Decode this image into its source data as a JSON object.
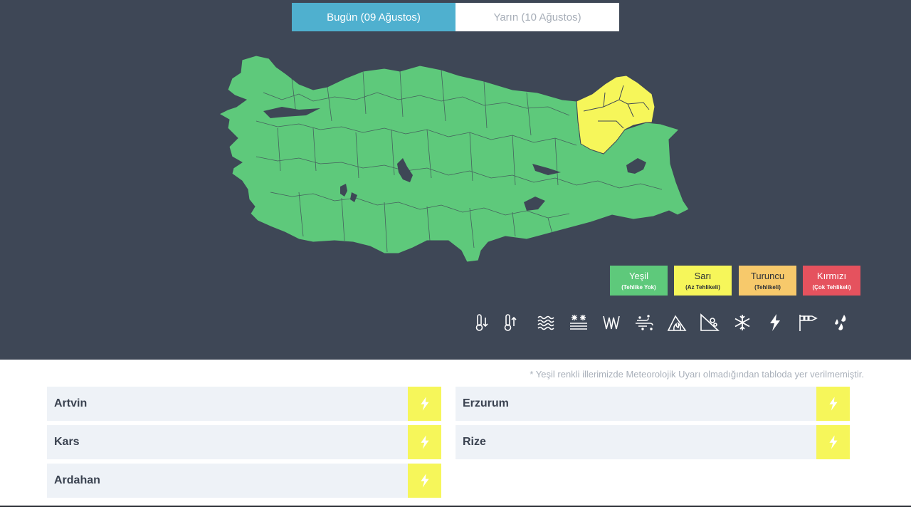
{
  "tabs": {
    "today": "Bugün (09 Ağustos)",
    "tomorrow": "Yarın (10 Ağustos)"
  },
  "colors": {
    "green": "#5ec97b",
    "yellow": "#f6f65a",
    "orange": "#f7c96b",
    "red": "#e5525e",
    "background": "#3e4756"
  },
  "legend": [
    {
      "title": "Yeşil",
      "sub": "(Tehlike Yok)",
      "color": "#5ec97b"
    },
    {
      "title": "Sarı",
      "sub": "(Az Tehlikeli)",
      "color": "#f6f65a"
    },
    {
      "title": "Turuncu",
      "sub": "(Tehlikeli)",
      "color": "#f7c96b"
    },
    {
      "title": "Kırmızı",
      "sub": "(Çok Tehlikeli)",
      "color": "#e5525e"
    }
  ],
  "hazard_icons": [
    "cold-icon",
    "heat-icon",
    "fog-icon",
    "snow-melt-icon",
    "avalanche-grass-icon",
    "dust-icon",
    "forest-fire-icon",
    "landslide-icon",
    "snow-icon",
    "thunderstorm-icon",
    "wind-icon",
    "rain-icon"
  ],
  "note": "* Yeşil renkli illerimizde Meteorolojik Uyarı olmadığından tabloda yer verilmemiştir.",
  "warnings": [
    {
      "province": "Artvin",
      "level": "yellow",
      "hazard": "thunderstorm-icon"
    },
    {
      "province": "Erzurum",
      "level": "yellow",
      "hazard": "thunderstorm-icon"
    },
    {
      "province": "Kars",
      "level": "yellow",
      "hazard": "thunderstorm-icon"
    },
    {
      "province": "Rize",
      "level": "yellow",
      "hazard": "thunderstorm-icon"
    },
    {
      "province": "Ardahan",
      "level": "yellow",
      "hazard": "thunderstorm-icon"
    }
  ]
}
